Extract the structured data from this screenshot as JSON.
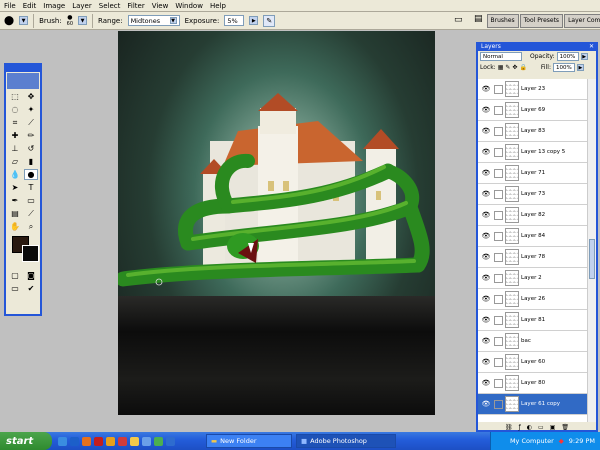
{
  "menu": [
    "File",
    "Edit",
    "Image",
    "Layer",
    "Select",
    "Filter",
    "View",
    "Window",
    "Help"
  ],
  "options": {
    "brush_label": "Brush:",
    "brush_size": "60",
    "range_label": "Range:",
    "range_value": "Midtones",
    "exposure_label": "Exposure:",
    "exposure_value": "5%"
  },
  "palette_well": [
    "Brushes",
    "Tool Presets",
    "Layer Comps"
  ],
  "layers_panel": {
    "title": "Layers",
    "blend_mode": "Normal",
    "opacity_label": "Opacity:",
    "opacity_value": "100%",
    "lock_label": "Lock:",
    "fill_label": "Fill:",
    "fill_value": "100%",
    "layers": [
      {
        "name": "Layer 23"
      },
      {
        "name": "Layer 69"
      },
      {
        "name": "Layer 83"
      },
      {
        "name": "Layer 13 copy 5"
      },
      {
        "name": "Layer 71"
      },
      {
        "name": "Layer 73"
      },
      {
        "name": "Layer 82"
      },
      {
        "name": "Layer 84"
      },
      {
        "name": "Layer 78"
      },
      {
        "name": "Layer 2"
      },
      {
        "name": "Layer 26"
      },
      {
        "name": "Layer 81"
      },
      {
        "name": "bac"
      },
      {
        "name": "Layer 60"
      },
      {
        "name": "Layer 80"
      },
      {
        "name": "Layer 61 copy"
      }
    ],
    "selected_index": 15
  },
  "taskbar": {
    "start": "start",
    "tasks": [
      "New Folder",
      "Adobe Photoshop"
    ],
    "tray_label": "My Computer",
    "clock": "9:29 PM"
  },
  "colors": {
    "accent": "#2456d8",
    "selection": "#316ac5"
  }
}
